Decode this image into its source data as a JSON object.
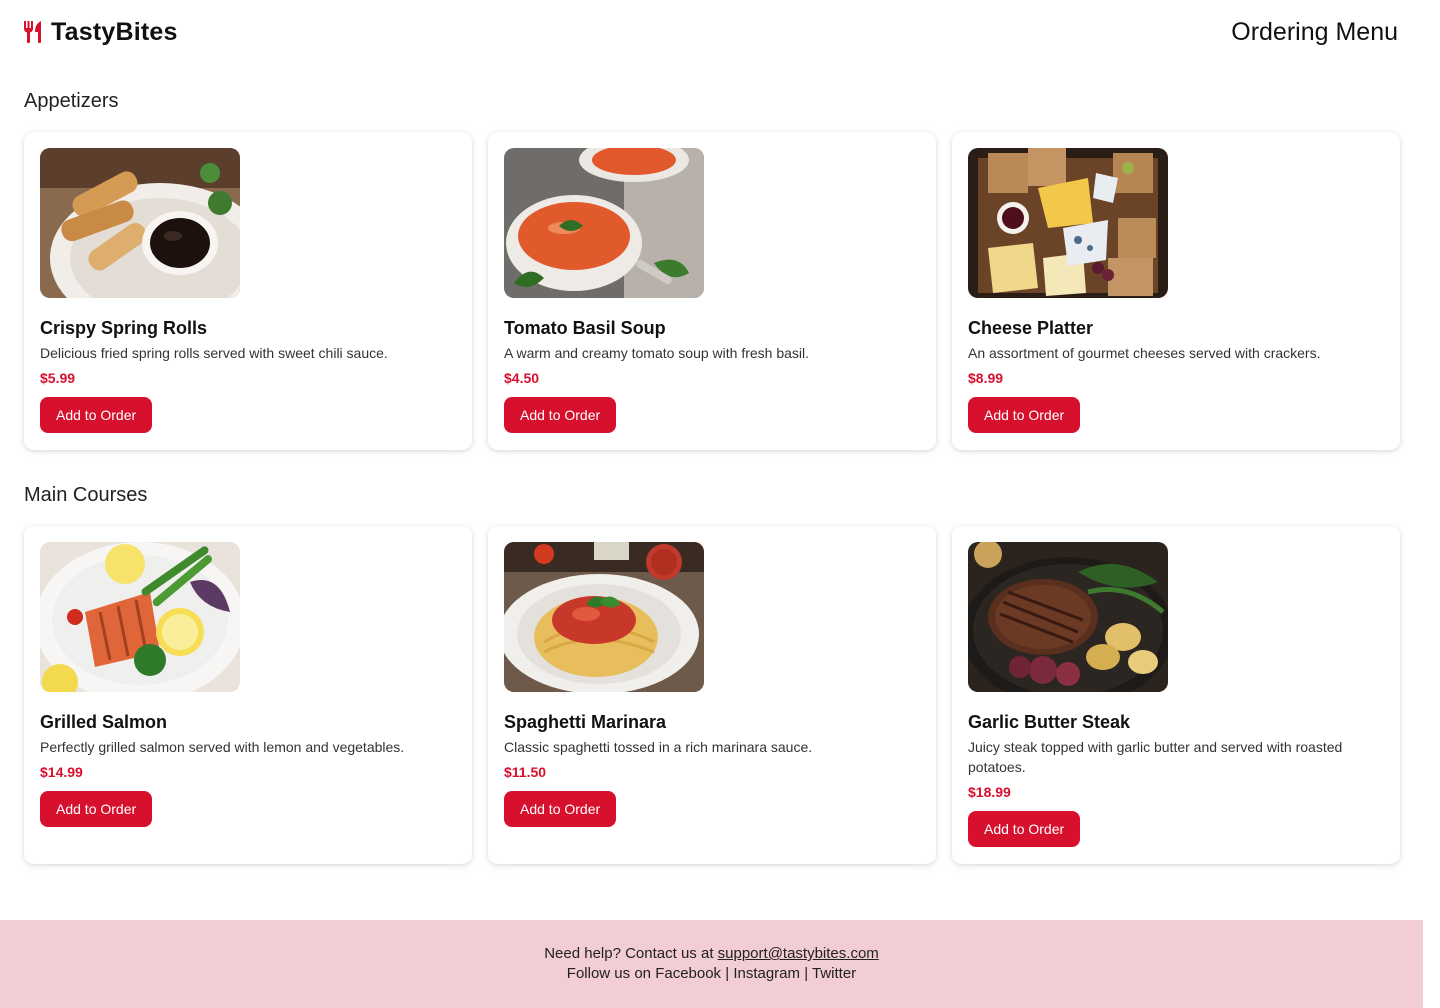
{
  "header": {
    "brand_name": "TastyBites",
    "brand_icon": "utensils-icon",
    "page_title": "Ordering Menu"
  },
  "colors": {
    "accent": "#d7102e",
    "footer_bg": "#f2cdd3"
  },
  "sections": [
    {
      "title": "Appetizers",
      "items": [
        {
          "name": "Crispy Spring Rolls",
          "description": "Delicious fried spring rolls served with sweet chili sauce.",
          "price": "$5.99",
          "button": "Add to Order",
          "image": "spring-rolls-image"
        },
        {
          "name": "Tomato Basil Soup",
          "description": "A warm and creamy tomato soup with fresh basil.",
          "price": "$4.50",
          "button": "Add to Order",
          "image": "tomato-soup-image"
        },
        {
          "name": "Cheese Platter",
          "description": "An assortment of gourmet cheeses served with crackers.",
          "price": "$8.99",
          "button": "Add to Order",
          "image": "cheese-platter-image"
        }
      ]
    },
    {
      "title": "Main Courses",
      "items": [
        {
          "name": "Grilled Salmon",
          "description": "Perfectly grilled salmon served with lemon and vegetables.",
          "price": "$14.99",
          "button": "Add to Order",
          "image": "grilled-salmon-image"
        },
        {
          "name": "Spaghetti Marinara",
          "description": "Classic spaghetti tossed in a rich marinara sauce.",
          "price": "$11.50",
          "button": "Add to Order",
          "image": "spaghetti-image"
        },
        {
          "name": "Garlic Butter Steak",
          "description": "Juicy steak topped with garlic butter and served with roasted potatoes.",
          "price": "$18.99",
          "button": "Add to Order",
          "image": "steak-image"
        }
      ]
    }
  ],
  "footer": {
    "help_text": "Need help? Contact us at",
    "email": "support@tastybites.com",
    "follow_prefix": "Follow us on",
    "social": [
      "Facebook",
      "Instagram",
      "Twitter"
    ]
  }
}
